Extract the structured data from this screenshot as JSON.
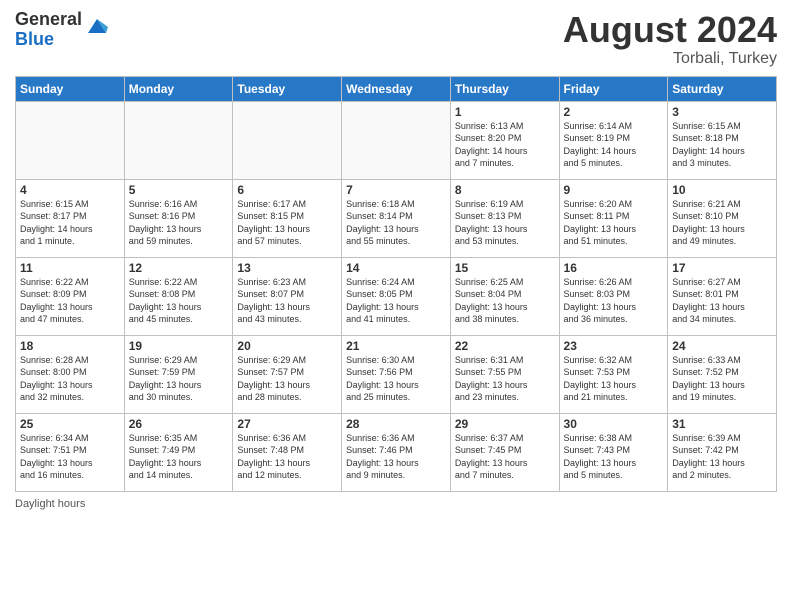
{
  "logo": {
    "general": "General",
    "blue": "Blue"
  },
  "title": {
    "month_year": "August 2024",
    "location": "Torbali, Turkey"
  },
  "header_days": [
    "Sunday",
    "Monday",
    "Tuesday",
    "Wednesday",
    "Thursday",
    "Friday",
    "Saturday"
  ],
  "weeks": [
    [
      {
        "day": "",
        "info": ""
      },
      {
        "day": "",
        "info": ""
      },
      {
        "day": "",
        "info": ""
      },
      {
        "day": "",
        "info": ""
      },
      {
        "day": "1",
        "info": "Sunrise: 6:13 AM\nSunset: 8:20 PM\nDaylight: 14 hours\nand 7 minutes."
      },
      {
        "day": "2",
        "info": "Sunrise: 6:14 AM\nSunset: 8:19 PM\nDaylight: 14 hours\nand 5 minutes."
      },
      {
        "day": "3",
        "info": "Sunrise: 6:15 AM\nSunset: 8:18 PM\nDaylight: 14 hours\nand 3 minutes."
      }
    ],
    [
      {
        "day": "4",
        "info": "Sunrise: 6:15 AM\nSunset: 8:17 PM\nDaylight: 14 hours\nand 1 minute."
      },
      {
        "day": "5",
        "info": "Sunrise: 6:16 AM\nSunset: 8:16 PM\nDaylight: 13 hours\nand 59 minutes."
      },
      {
        "day": "6",
        "info": "Sunrise: 6:17 AM\nSunset: 8:15 PM\nDaylight: 13 hours\nand 57 minutes."
      },
      {
        "day": "7",
        "info": "Sunrise: 6:18 AM\nSunset: 8:14 PM\nDaylight: 13 hours\nand 55 minutes."
      },
      {
        "day": "8",
        "info": "Sunrise: 6:19 AM\nSunset: 8:13 PM\nDaylight: 13 hours\nand 53 minutes."
      },
      {
        "day": "9",
        "info": "Sunrise: 6:20 AM\nSunset: 8:11 PM\nDaylight: 13 hours\nand 51 minutes."
      },
      {
        "day": "10",
        "info": "Sunrise: 6:21 AM\nSunset: 8:10 PM\nDaylight: 13 hours\nand 49 minutes."
      }
    ],
    [
      {
        "day": "11",
        "info": "Sunrise: 6:22 AM\nSunset: 8:09 PM\nDaylight: 13 hours\nand 47 minutes."
      },
      {
        "day": "12",
        "info": "Sunrise: 6:22 AM\nSunset: 8:08 PM\nDaylight: 13 hours\nand 45 minutes."
      },
      {
        "day": "13",
        "info": "Sunrise: 6:23 AM\nSunset: 8:07 PM\nDaylight: 13 hours\nand 43 minutes."
      },
      {
        "day": "14",
        "info": "Sunrise: 6:24 AM\nSunset: 8:05 PM\nDaylight: 13 hours\nand 41 minutes."
      },
      {
        "day": "15",
        "info": "Sunrise: 6:25 AM\nSunset: 8:04 PM\nDaylight: 13 hours\nand 38 minutes."
      },
      {
        "day": "16",
        "info": "Sunrise: 6:26 AM\nSunset: 8:03 PM\nDaylight: 13 hours\nand 36 minutes."
      },
      {
        "day": "17",
        "info": "Sunrise: 6:27 AM\nSunset: 8:01 PM\nDaylight: 13 hours\nand 34 minutes."
      }
    ],
    [
      {
        "day": "18",
        "info": "Sunrise: 6:28 AM\nSunset: 8:00 PM\nDaylight: 13 hours\nand 32 minutes."
      },
      {
        "day": "19",
        "info": "Sunrise: 6:29 AM\nSunset: 7:59 PM\nDaylight: 13 hours\nand 30 minutes."
      },
      {
        "day": "20",
        "info": "Sunrise: 6:29 AM\nSunset: 7:57 PM\nDaylight: 13 hours\nand 28 minutes."
      },
      {
        "day": "21",
        "info": "Sunrise: 6:30 AM\nSunset: 7:56 PM\nDaylight: 13 hours\nand 25 minutes."
      },
      {
        "day": "22",
        "info": "Sunrise: 6:31 AM\nSunset: 7:55 PM\nDaylight: 13 hours\nand 23 minutes."
      },
      {
        "day": "23",
        "info": "Sunrise: 6:32 AM\nSunset: 7:53 PM\nDaylight: 13 hours\nand 21 minutes."
      },
      {
        "day": "24",
        "info": "Sunrise: 6:33 AM\nSunset: 7:52 PM\nDaylight: 13 hours\nand 19 minutes."
      }
    ],
    [
      {
        "day": "25",
        "info": "Sunrise: 6:34 AM\nSunset: 7:51 PM\nDaylight: 13 hours\nand 16 minutes."
      },
      {
        "day": "26",
        "info": "Sunrise: 6:35 AM\nSunset: 7:49 PM\nDaylight: 13 hours\nand 14 minutes."
      },
      {
        "day": "27",
        "info": "Sunrise: 6:36 AM\nSunset: 7:48 PM\nDaylight: 13 hours\nand 12 minutes."
      },
      {
        "day": "28",
        "info": "Sunrise: 6:36 AM\nSunset: 7:46 PM\nDaylight: 13 hours\nand 9 minutes."
      },
      {
        "day": "29",
        "info": "Sunrise: 6:37 AM\nSunset: 7:45 PM\nDaylight: 13 hours\nand 7 minutes."
      },
      {
        "day": "30",
        "info": "Sunrise: 6:38 AM\nSunset: 7:43 PM\nDaylight: 13 hours\nand 5 minutes."
      },
      {
        "day": "31",
        "info": "Sunrise: 6:39 AM\nSunset: 7:42 PM\nDaylight: 13 hours\nand 2 minutes."
      }
    ]
  ],
  "footer": {
    "daylight_hours_label": "Daylight hours"
  }
}
